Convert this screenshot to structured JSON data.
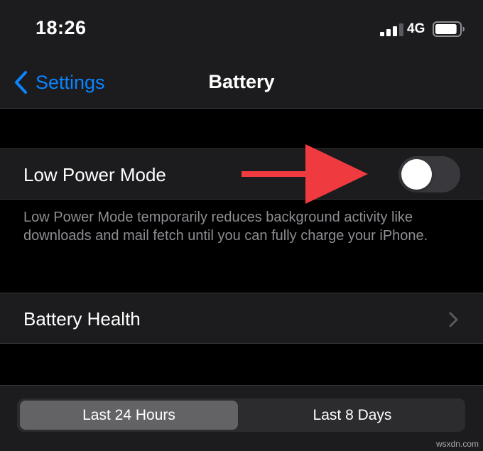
{
  "status_bar": {
    "time": "18:26",
    "network": "4G",
    "signal_bars_filled": 3,
    "signal_bars_total": 4,
    "battery_level": 0.9
  },
  "nav": {
    "back_label": "Settings",
    "title": "Battery"
  },
  "low_power": {
    "label": "Low Power Mode",
    "enabled": false,
    "footnote": "Low Power Mode temporarily reduces background activity like downloads and mail fetch until you can fully charge your iPhone."
  },
  "battery_health": {
    "label": "Battery Health"
  },
  "segmented_control": {
    "options": [
      "Last 24 Hours",
      "Last 8 Days"
    ],
    "selected_index": 0
  },
  "annotation": {
    "arrow_color": "#ef3b3f",
    "points_to": "low-power-mode-toggle"
  },
  "watermark": "wsxdn.com",
  "colors": {
    "accent": "#0a84ff",
    "background": "#000000",
    "cell": "#1c1c1e",
    "secondary_text": "#8e8e93"
  },
  "icons": {
    "back": "chevron-left-icon",
    "disclosure": "chevron-right-icon",
    "signal": "cellular-signal-icon",
    "battery": "battery-icon"
  }
}
